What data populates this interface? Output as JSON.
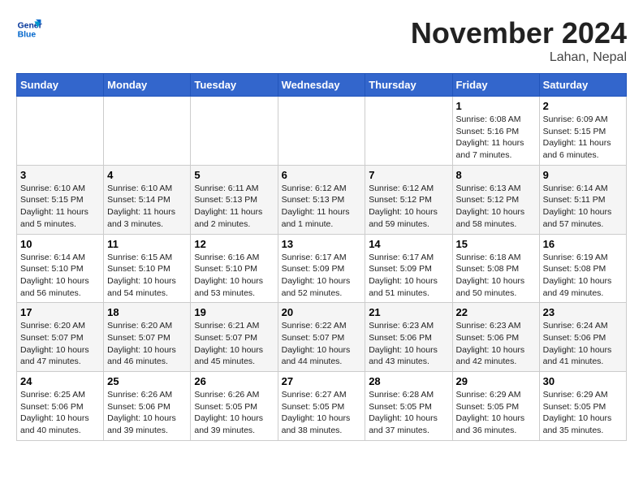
{
  "header": {
    "logo_line1": "General",
    "logo_line2": "Blue",
    "month_title": "November 2024",
    "location": "Lahan, Nepal"
  },
  "weekdays": [
    "Sunday",
    "Monday",
    "Tuesday",
    "Wednesday",
    "Thursday",
    "Friday",
    "Saturday"
  ],
  "weeks": [
    [
      {
        "day": "",
        "info": ""
      },
      {
        "day": "",
        "info": ""
      },
      {
        "day": "",
        "info": ""
      },
      {
        "day": "",
        "info": ""
      },
      {
        "day": "",
        "info": ""
      },
      {
        "day": "1",
        "info": "Sunrise: 6:08 AM\nSunset: 5:16 PM\nDaylight: 11 hours and 7 minutes."
      },
      {
        "day": "2",
        "info": "Sunrise: 6:09 AM\nSunset: 5:15 PM\nDaylight: 11 hours and 6 minutes."
      }
    ],
    [
      {
        "day": "3",
        "info": "Sunrise: 6:10 AM\nSunset: 5:15 PM\nDaylight: 11 hours and 5 minutes."
      },
      {
        "day": "4",
        "info": "Sunrise: 6:10 AM\nSunset: 5:14 PM\nDaylight: 11 hours and 3 minutes."
      },
      {
        "day": "5",
        "info": "Sunrise: 6:11 AM\nSunset: 5:13 PM\nDaylight: 11 hours and 2 minutes."
      },
      {
        "day": "6",
        "info": "Sunrise: 6:12 AM\nSunset: 5:13 PM\nDaylight: 11 hours and 1 minute."
      },
      {
        "day": "7",
        "info": "Sunrise: 6:12 AM\nSunset: 5:12 PM\nDaylight: 10 hours and 59 minutes."
      },
      {
        "day": "8",
        "info": "Sunrise: 6:13 AM\nSunset: 5:12 PM\nDaylight: 10 hours and 58 minutes."
      },
      {
        "day": "9",
        "info": "Sunrise: 6:14 AM\nSunset: 5:11 PM\nDaylight: 10 hours and 57 minutes."
      }
    ],
    [
      {
        "day": "10",
        "info": "Sunrise: 6:14 AM\nSunset: 5:10 PM\nDaylight: 10 hours and 56 minutes."
      },
      {
        "day": "11",
        "info": "Sunrise: 6:15 AM\nSunset: 5:10 PM\nDaylight: 10 hours and 54 minutes."
      },
      {
        "day": "12",
        "info": "Sunrise: 6:16 AM\nSunset: 5:10 PM\nDaylight: 10 hours and 53 minutes."
      },
      {
        "day": "13",
        "info": "Sunrise: 6:17 AM\nSunset: 5:09 PM\nDaylight: 10 hours and 52 minutes."
      },
      {
        "day": "14",
        "info": "Sunrise: 6:17 AM\nSunset: 5:09 PM\nDaylight: 10 hours and 51 minutes."
      },
      {
        "day": "15",
        "info": "Sunrise: 6:18 AM\nSunset: 5:08 PM\nDaylight: 10 hours and 50 minutes."
      },
      {
        "day": "16",
        "info": "Sunrise: 6:19 AM\nSunset: 5:08 PM\nDaylight: 10 hours and 49 minutes."
      }
    ],
    [
      {
        "day": "17",
        "info": "Sunrise: 6:20 AM\nSunset: 5:07 PM\nDaylight: 10 hours and 47 minutes."
      },
      {
        "day": "18",
        "info": "Sunrise: 6:20 AM\nSunset: 5:07 PM\nDaylight: 10 hours and 46 minutes."
      },
      {
        "day": "19",
        "info": "Sunrise: 6:21 AM\nSunset: 5:07 PM\nDaylight: 10 hours and 45 minutes."
      },
      {
        "day": "20",
        "info": "Sunrise: 6:22 AM\nSunset: 5:07 PM\nDaylight: 10 hours and 44 minutes."
      },
      {
        "day": "21",
        "info": "Sunrise: 6:23 AM\nSunset: 5:06 PM\nDaylight: 10 hours and 43 minutes."
      },
      {
        "day": "22",
        "info": "Sunrise: 6:23 AM\nSunset: 5:06 PM\nDaylight: 10 hours and 42 minutes."
      },
      {
        "day": "23",
        "info": "Sunrise: 6:24 AM\nSunset: 5:06 PM\nDaylight: 10 hours and 41 minutes."
      }
    ],
    [
      {
        "day": "24",
        "info": "Sunrise: 6:25 AM\nSunset: 5:06 PM\nDaylight: 10 hours and 40 minutes."
      },
      {
        "day": "25",
        "info": "Sunrise: 6:26 AM\nSunset: 5:06 PM\nDaylight: 10 hours and 39 minutes."
      },
      {
        "day": "26",
        "info": "Sunrise: 6:26 AM\nSunset: 5:05 PM\nDaylight: 10 hours and 39 minutes."
      },
      {
        "day": "27",
        "info": "Sunrise: 6:27 AM\nSunset: 5:05 PM\nDaylight: 10 hours and 38 minutes."
      },
      {
        "day": "28",
        "info": "Sunrise: 6:28 AM\nSunset: 5:05 PM\nDaylight: 10 hours and 37 minutes."
      },
      {
        "day": "29",
        "info": "Sunrise: 6:29 AM\nSunset: 5:05 PM\nDaylight: 10 hours and 36 minutes."
      },
      {
        "day": "30",
        "info": "Sunrise: 6:29 AM\nSunset: 5:05 PM\nDaylight: 10 hours and 35 minutes."
      }
    ]
  ]
}
